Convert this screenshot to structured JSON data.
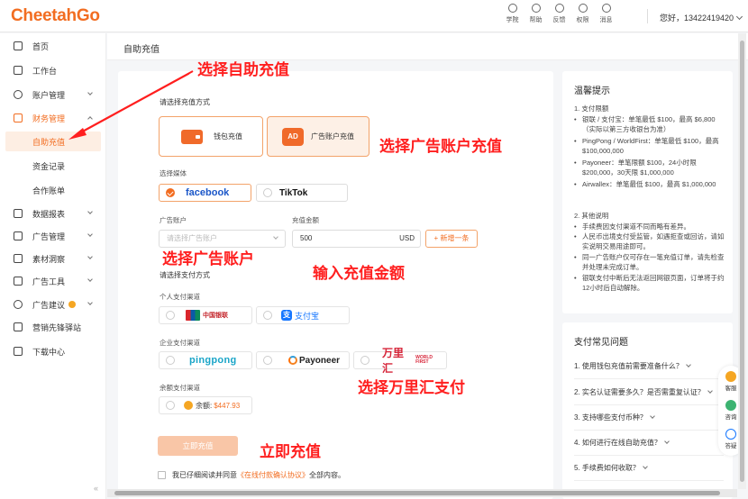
{
  "brand": {
    "logo": "CheetahGo",
    "accent": "#f26d21"
  },
  "topbar": {
    "icons": [
      {
        "label": "学院",
        "icon": "graduation-cap-icon"
      },
      {
        "label": "帮助",
        "icon": "help-book-icon"
      },
      {
        "label": "反馈",
        "icon": "feedback-icon"
      },
      {
        "label": "权限",
        "icon": "lock-icon"
      },
      {
        "label": "消息",
        "icon": "bell-icon"
      }
    ],
    "greeting": "您好，13422419420"
  },
  "sidebar": {
    "items": [
      {
        "label": "首页"
      },
      {
        "label": "工作台"
      },
      {
        "label": "账户管理"
      },
      {
        "label": "财务管理"
      },
      {
        "label": "自助充值"
      },
      {
        "label": "资金记录"
      },
      {
        "label": "合作账单"
      },
      {
        "label": "数据报表"
      },
      {
        "label": "广告管理"
      },
      {
        "label": "素材洞察"
      },
      {
        "label": "广告工具"
      },
      {
        "label": "广告建议"
      },
      {
        "label": "营销先锋驿站"
      },
      {
        "label": "下载中心"
      }
    ],
    "collapse": "«"
  },
  "page": {
    "title": "自助充值"
  },
  "form": {
    "method_label": "请选择充值方式",
    "method_wallet": "钱包充值",
    "method_ad_icon": "AD",
    "method_ad": "广告账户充值",
    "media_label": "选择媒体",
    "media_facebook": "facebook",
    "media_tiktok": "TikTok",
    "account_label": "广告账户",
    "account_placeholder": "请选择广告账户",
    "amount_label": "充值金额",
    "amount_value": "500",
    "amount_unit": "USD",
    "add_button": "+ 新增一条",
    "pay_method_label": "请选择支付方式",
    "personal_label": "个人支付渠道",
    "unionpay_text": "中国银联",
    "alipay_icon": "支",
    "alipay_text": "支付宝",
    "enterprise_label": "企业支付渠道",
    "pingpong_text": "pingpong",
    "payoneer_text": "Payoneer",
    "worldfirst_text": "万里汇",
    "worldfirst_small": "WORLD FIRST",
    "balance_channel_label": "余额支付渠道",
    "balance_label": "余额:",
    "balance_amount": "$447.93",
    "submit": "立即充值",
    "agree_prefix": "我已仔细阅读并同意",
    "agree_link": "《在线付款确认协议》",
    "agree_suffix": "全部内容。"
  },
  "annotations": {
    "a1": "选择自助充值",
    "a2": "选择广告账户充值",
    "a3": "选择广告账户",
    "a4": "输入充值金额",
    "a5": "选择万里汇支付",
    "a6": "立即充值"
  },
  "tips": {
    "title": "温馨提示",
    "section1": "1. 支付限额",
    "s1_items": [
      "银联 / 支付宝：单笔最低 $100，最高 $6,800（实际以第三方收银台为准）",
      "PingPong / WorldFirst：单笔最低 $100，最高 $100,000,000",
      "Payoneer：单笔限额 $100，24小时限 $200,000，30天限 $1,000,000",
      "Airwallex：单笔最低 $100，最高 $1,000,000"
    ],
    "section2": "2. 其他说明",
    "s2_items": [
      "手续费因支付渠道不同而略有差异。",
      "人民币出境支付受监管，如遇拒查或回访，请如实说明交易用途即可。",
      "同一广告账户仅可存在一笔充值订单，请先检查并处理未完成订单。",
      "银联支付中断后无法返回网银页面，订单将于约 12小时后自动解除。"
    ]
  },
  "faq": {
    "title": "支付常见问题",
    "items": [
      "1. 使用钱包充值前需要准备什么？",
      "2. 实名认证需要多久？是否需重复认证？",
      "3. 支持哪些支付币种？",
      "4. 如何进行在线自助充值？",
      "5. 手续费如何收取？"
    ]
  },
  "float_bar": {
    "service": "客服",
    "consult": "咨询",
    "help": "答疑"
  }
}
